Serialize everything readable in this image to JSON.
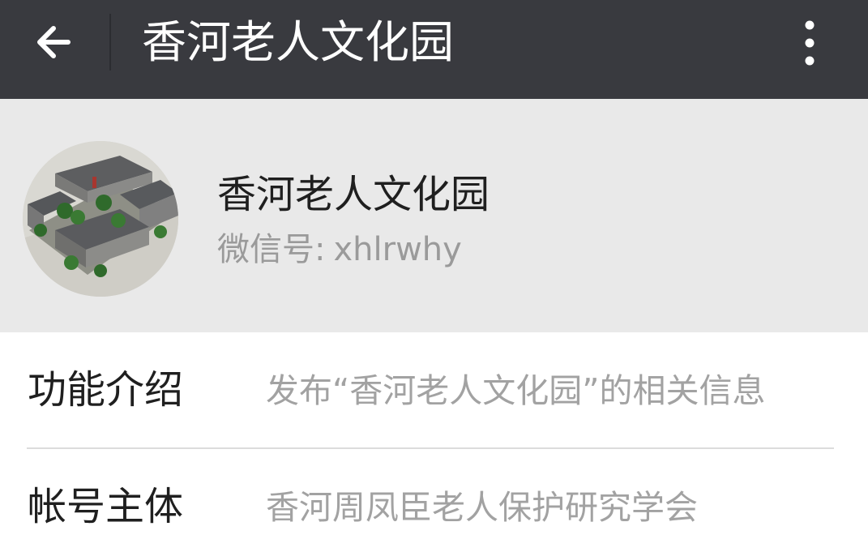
{
  "header": {
    "title": "香河老人文化园",
    "back_icon": "arrow-left-icon",
    "more_icon": "more-vertical-icon",
    "background": "#393a3f"
  },
  "profile": {
    "name": "香河老人文化园",
    "wechat_id_label": "微信号:",
    "wechat_id": "xhlrwhy",
    "avatar": "courtyard-building-avatar"
  },
  "info_rows": [
    {
      "label": "功能介绍",
      "value": "发布“香河老人文化园”的相关信息"
    },
    {
      "label": "帐号主体",
      "value": "香河周凤臣老人保护研究学会"
    }
  ]
}
